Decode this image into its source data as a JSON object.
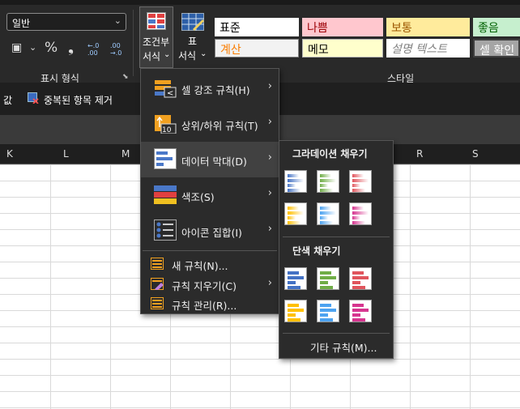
{
  "ribbon": {
    "number_format_value": "일반",
    "currency_glyph": "▣",
    "percent_glyph": "%",
    "comma_glyph": "❟",
    "dec_inc_glyph": "←.0 .00",
    "dec_dec_glyph": ".00 →.0",
    "number_group_label": "표시 형식",
    "dialog_launcher": "⬊",
    "cond_format_label_1": "조건부",
    "cond_format_label_2": "서식",
    "table_format_label_1": "표",
    "table_format_label_2": "서식",
    "style_group_label": "스타일",
    "dropdown_caret": "⌄",
    "styles": [
      {
        "label": "표준",
        "bg": "#ffffff",
        "color": "#000000"
      },
      {
        "label": "나쁨",
        "bg": "#ffc7ce",
        "color": "#9c0006"
      },
      {
        "label": "보통",
        "bg": "#ffeb9c",
        "color": "#9c5700"
      },
      {
        "label": "좋음",
        "bg": "#c6efce",
        "color": "#006100"
      },
      {
        "label": "계산",
        "bg": "#f2f2f2",
        "color": "#fa7d00"
      },
      {
        "label": "메모",
        "bg": "#ffffcc",
        "color": "#000000"
      },
      {
        "label": "설명 텍스트",
        "bg": "#ffffff",
        "color": "#7f7f7f"
      },
      {
        "label": "셀 확인",
        "bg": "#a5a5a5",
        "color": "#ffffff"
      }
    ]
  },
  "command_row": {
    "left_text": "값",
    "remove_dup_label": "중복된 항목 제거"
  },
  "columns": [
    "K",
    "L",
    "M",
    "R",
    "S"
  ],
  "main_menu": {
    "items": [
      {
        "label": "셀 강조 규칙(H)",
        "icon": "highlight-rules-icon"
      },
      {
        "label": "상위/하위 규칙(T)",
        "icon": "top-bottom-icon"
      },
      {
        "label": "데이터 막대(D)",
        "icon": "data-bars-icon"
      },
      {
        "label": "색조(S)",
        "icon": "color-scales-icon"
      },
      {
        "label": "아이콘 집합(I)",
        "icon": "icon-sets-icon"
      }
    ],
    "small_items": [
      {
        "label": "새 규칙(N)..."
      },
      {
        "label": "규칙 지우기(C)"
      },
      {
        "label": "규칙 관리(R)..."
      }
    ],
    "top_badge": "10",
    "highlight_badge": "<",
    "arrow": "›"
  },
  "submenu": {
    "gradient_header": "그라데이션 채우기",
    "solid_header": "단색 채우기",
    "more_rules": "기타 규칙(M)...",
    "bar_colors": [
      "#4472c4",
      "#70ad47",
      "#e0555d",
      "#ffc000",
      "#4da3f0",
      "#d6358f"
    ]
  }
}
